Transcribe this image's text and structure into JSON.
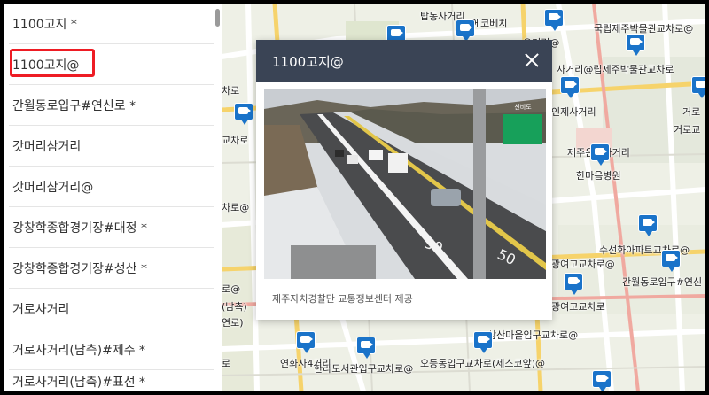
{
  "sidebar": {
    "items": [
      {
        "label": "1100고지 *"
      },
      {
        "label": "1100고지@",
        "highlighted": true
      },
      {
        "label": "간월동로입구#연신로 *"
      },
      {
        "label": "갓머리삼거리"
      },
      {
        "label": "갓머리삼거리@"
      },
      {
        "label": "강창학종합경기장#대정 *"
      },
      {
        "label": "강창학종합경기장#성산 *"
      },
      {
        "label": "거로사거리"
      },
      {
        "label": "거로사거리(남측)#제주 *"
      },
      {
        "label": "거로사거리(남측)#표선 *"
      }
    ]
  },
  "map": {
    "labels": [
      {
        "text": "탑동사거리"
      },
      {
        "text": "국립제주박물관교차로@"
      },
      {
        "text": "오거리@"
      },
      {
        "text": "사거리@립제주박물관교차로"
      },
      {
        "text": "차로"
      },
      {
        "text": "인제사거리"
      },
      {
        "text": "거로"
      },
      {
        "text": "제주은행사거리"
      },
      {
        "text": "한마음병원"
      },
      {
        "text": "차로@"
      },
      {
        "text": "수선화아파트교차로@"
      },
      {
        "text": "광여고교차로@"
      },
      {
        "text": "간월동로입구#연신"
      },
      {
        "text": "광여고교차로"
      },
      {
        "text": "삼산마을입구교차로@"
      },
      {
        "text": "한라도서관입구교차로@"
      },
      {
        "text": "오등동입구교차로(제스코앞)@"
      },
      {
        "text": "연화사4거리"
      },
      {
        "text": "거로교"
      },
      {
        "text": "(남측)"
      },
      {
        "text": "연로)"
      },
      {
        "text": "로@"
      },
      {
        "text": "로"
      },
      {
        "text": "에코베치"
      },
      {
        "text": "교차로"
      }
    ]
  },
  "popup": {
    "title": "1100고지@",
    "caption": "제주자치경찰단 교통정보센터 제공",
    "sign_text": "신비도"
  },
  "colors": {
    "highlight_border": "#ee1c24",
    "popup_header": "#3a4455",
    "camera_pin": "#1a73c9"
  }
}
